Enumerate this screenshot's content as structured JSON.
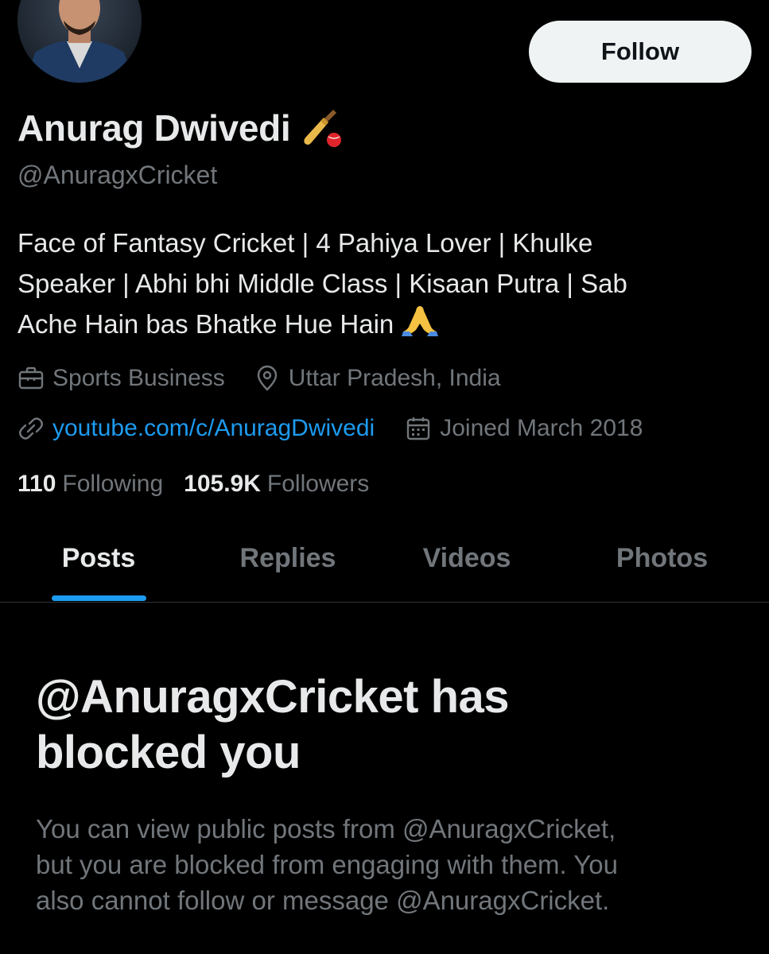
{
  "profile": {
    "display_name": "Anurag Dwivedi",
    "handle": "@AnuragxCricket",
    "bio_lines": [
      "Face of Fantasy Cricket | 4 Pahiya Lover | Khulke",
      "Speaker | Abhi bhi Middle Class | Kisaan Putra | Sab",
      "Ache Hain bas Bhatke Hue Hain"
    ],
    "category": "Sports Business",
    "location": "Uttar Pradesh, India",
    "website": "youtube.com/c/AnuragDwivedi",
    "joined": "Joined March 2018",
    "following_count": "110",
    "following_label": "Following",
    "followers_count": "105.9K",
    "followers_label": "Followers",
    "name_emoji_icon": "cricket-bat-ball-icon",
    "bio_emoji_icon": "folded-hands-icon"
  },
  "header": {
    "follow_label": "Follow"
  },
  "tabs": [
    {
      "label": "Posts",
      "active": true
    },
    {
      "label": "Replies",
      "active": false
    },
    {
      "label": "Videos",
      "active": false
    },
    {
      "label": "Photos",
      "active": false
    }
  ],
  "blocked": {
    "title_lines": [
      "@AnuragxCricket has",
      "blocked you"
    ],
    "description_lines": [
      "You can view public posts from @AnuragxCricket,",
      "but you are blocked from engaging with them. You",
      "also cannot follow or message @AnuragxCricket."
    ]
  },
  "colors": {
    "background": "#000000",
    "primary_text": "#e7e9ea",
    "secondary_text": "#71767b",
    "accent": "#1d9bf0",
    "follow_button_bg": "#eff3f4",
    "divider": "#2f3336"
  }
}
